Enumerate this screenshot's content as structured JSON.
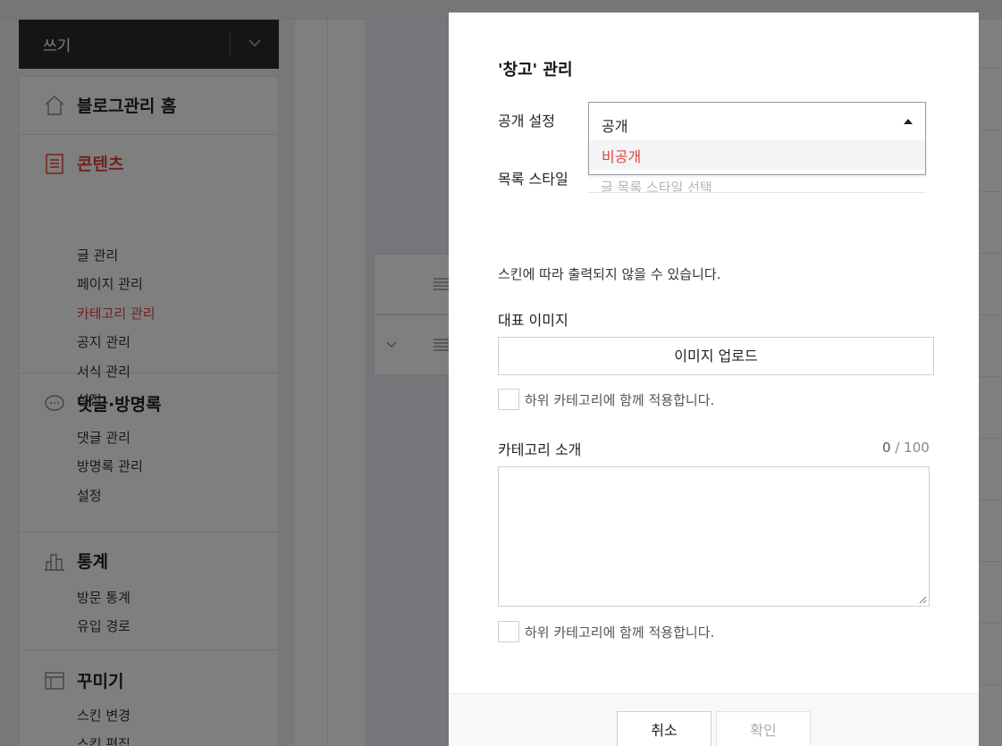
{
  "write_bar": {
    "label": "쓰기",
    "menu_icon": "chevron-down-icon"
  },
  "sidebar": {
    "home": {
      "label": "블로그관리 홈",
      "icon": "home-icon"
    },
    "contents": {
      "label": "콘텐츠",
      "icon": "document-icon",
      "items": [
        {
          "label": "글 관리",
          "active": false
        },
        {
          "label": "페이지 관리",
          "active": false
        },
        {
          "label": "카테고리 관리",
          "active": true
        },
        {
          "label": "공지 관리",
          "active": false
        },
        {
          "label": "서식 관리",
          "active": false
        },
        {
          "label": "설정",
          "active": false
        }
      ]
    },
    "comments": {
      "label": "댓글·방명록",
      "icon": "speech-bubble-icon",
      "items": [
        {
          "label": "댓글 관리"
        },
        {
          "label": "방명록 관리"
        },
        {
          "label": "설정"
        }
      ]
    },
    "stats": {
      "label": "통계",
      "icon": "bar-chart-icon",
      "items": [
        {
          "label": "방문 통계"
        },
        {
          "label": "유입 경로"
        }
      ]
    },
    "design": {
      "label": "꾸미기",
      "icon": "layout-icon",
      "items": [
        {
          "label": "스킨 변경"
        },
        {
          "label": "스킨 편집"
        }
      ]
    }
  },
  "modal": {
    "title": "'창고' 관리",
    "visibility": {
      "label": "공개 설정",
      "selected": "공개",
      "options": [
        "비공개"
      ]
    },
    "list_style": {
      "label": "목록 스타일",
      "value": "글 목록 스타일 선택"
    },
    "notice": "스킨에 따라 출력되지 않을 수 있습니다.",
    "image": {
      "label": "대표 이미지",
      "upload_button": "이미지 업로드",
      "apply_children": "하위 카테고리에 함께 적용합니다."
    },
    "description": {
      "label": "카테고리 소개",
      "count": "0",
      "max": "/ 100",
      "value": "",
      "apply_children": "하위 카테고리에 함께 적용합니다."
    },
    "footer": {
      "cancel": "취소",
      "confirm": "확인"
    }
  },
  "colors": {
    "accent": "#e0463f",
    "overlay": "rgba(0,0,0,0.5)"
  }
}
